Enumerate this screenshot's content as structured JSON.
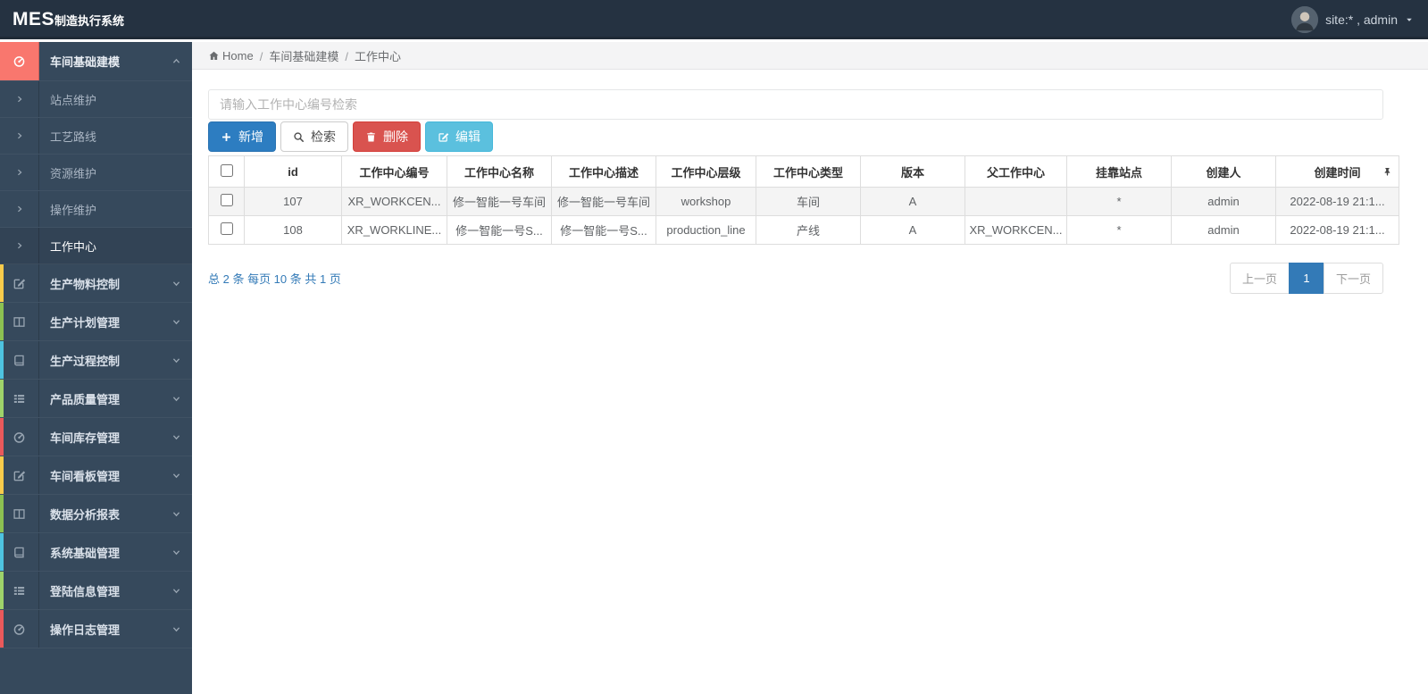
{
  "app": {
    "logo_primary": "MES",
    "logo_secondary": "制造执行系统"
  },
  "topbar": {
    "user_label": "site:* , admin"
  },
  "colors": {
    "topbar_bg": "#253241",
    "sidebar_bg": "#36495c",
    "active_group_icon_bg": "#f9776e",
    "primary_btn": "#2d7dc1",
    "danger_btn": "#d9534f",
    "info_btn": "#5bc0de",
    "pagination_active": "#337ab7",
    "accent_cycle": [
      "#f8cb4b",
      "#8cc152",
      "#4ec3e0",
      "#9ed36a",
      "#e9595b"
    ]
  },
  "sidebar": {
    "active_group": {
      "label": "车间基础建模",
      "icon": "gauge-icon"
    },
    "sub_items": [
      {
        "label": "站点维护",
        "active": false
      },
      {
        "label": "工艺路线",
        "active": false
      },
      {
        "label": "资源维护",
        "active": false
      },
      {
        "label": "操作维护",
        "active": false
      },
      {
        "label": "工作中心",
        "active": true
      }
    ],
    "groups": [
      {
        "label": "生产物料控制",
        "icon": "edit-icon",
        "accent": "#f8cb4b"
      },
      {
        "label": "生产计划管理",
        "icon": "columns-icon",
        "accent": "#8cc152"
      },
      {
        "label": "生产过程控制",
        "icon": "book-icon",
        "accent": "#4ec3e0"
      },
      {
        "label": "产品质量管理",
        "icon": "list-icon",
        "accent": "#9ed36a"
      },
      {
        "label": "车间库存管理",
        "icon": "gauge-icon",
        "accent": "#e9595b"
      },
      {
        "label": "车间看板管理",
        "icon": "edit-icon",
        "accent": "#f8cb4b"
      },
      {
        "label": "数据分析报表",
        "icon": "columns-icon",
        "accent": "#8cc152"
      },
      {
        "label": "系统基础管理",
        "icon": "book-icon",
        "accent": "#4ec3e0"
      },
      {
        "label": "登陆信息管理",
        "icon": "list-icon",
        "accent": "#9ed36a"
      },
      {
        "label": "操作日志管理",
        "icon": "gauge-icon",
        "accent": "#e9595b"
      }
    ]
  },
  "breadcrumb": {
    "home": "Home",
    "separator": "/",
    "items": [
      "车间基础建模",
      "工作中心"
    ]
  },
  "search": {
    "placeholder": "请输入工作中心编号检索",
    "value": ""
  },
  "toolbar": {
    "add_label": "新增",
    "search_label": "检索",
    "delete_label": "删除",
    "edit_label": "编辑"
  },
  "table": {
    "columns": [
      "id",
      "工作中心编号",
      "工作中心名称",
      "工作中心描述",
      "工作中心层级",
      "工作中心类型",
      "版本",
      "父工作中心",
      "挂靠站点",
      "创建人",
      "创建时间"
    ],
    "rows": [
      {
        "checked": false,
        "striped": true,
        "cells": [
          "107",
          "XR_WORKCEN...",
          "修一智能一号车间",
          "修一智能一号车间",
          "workshop",
          "车间",
          "A",
          "",
          "*",
          "admin",
          "2022-08-19 21:1..."
        ]
      },
      {
        "checked": false,
        "striped": false,
        "cells": [
          "108",
          "XR_WORKLINE...",
          "修一智能一号S...",
          "修一智能一号S...",
          "production_line",
          "产线",
          "A",
          "XR_WORKCEN...",
          "*",
          "admin",
          "2022-08-19 21:1..."
        ]
      }
    ]
  },
  "pagination": {
    "summary": "总 2 条 每页 10 条 共 1 页",
    "prev_label": "上一页",
    "page": "1",
    "next_label": "下一页"
  }
}
